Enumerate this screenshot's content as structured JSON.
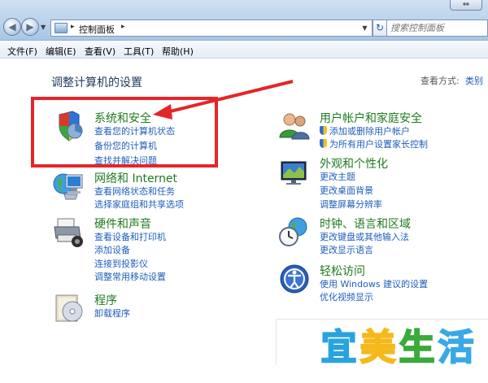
{
  "window": {
    "controls_glyph": "⇔"
  },
  "address_bar": {
    "path": "控制面板",
    "sep1": "▸",
    "sep2": "▸",
    "search_placeholder": "搜索控制面板"
  },
  "menu": [
    {
      "label": "文件(F)"
    },
    {
      "label": "编辑(E)"
    },
    {
      "label": "查看(V)"
    },
    {
      "label": "工具(T)"
    },
    {
      "label": "帮助(H)"
    }
  ],
  "content": {
    "title": "调整计算机的设置",
    "view_by_label": "查看方式:",
    "view_by_value": "类别",
    "categories": [
      {
        "title": "系统和安全",
        "links": [
          "查看您的计算机状态",
          "备份您的计算机",
          "查找并解决问题"
        ]
      },
      {
        "title": "网络和 Internet",
        "links": [
          "查看网络状态和任务",
          "选择家庭组和共享选项"
        ]
      },
      {
        "title": "硬件和声音",
        "links": [
          "查看设备和打印机",
          "添加设备",
          "连接到投影仪",
          "调整常用移动设置"
        ]
      },
      {
        "title": "程序",
        "links": [
          "卸载程序"
        ]
      },
      {
        "title": "用户帐户和家庭安全",
        "links": [
          "添加或删除用户帐户",
          "为所有用户设置家长控制"
        ]
      },
      {
        "title": "外观和个性化",
        "links": [
          "更改主题",
          "更改桌面背景",
          "调整屏幕分辨率"
        ]
      },
      {
        "title": "时钟、语言和区域",
        "links": [
          "更改键盘或其他输入法",
          "更改显示语言"
        ]
      },
      {
        "title": "轻松访问",
        "links": [
          "使用 Windows 建议的设置",
          "优化视频显示"
        ]
      }
    ]
  },
  "watermark": [
    "宜",
    "美",
    "生",
    "活"
  ],
  "colors": {
    "category_title": "#1f7a1f",
    "link": "#1e5ebd",
    "highlight": "#e4262a"
  }
}
